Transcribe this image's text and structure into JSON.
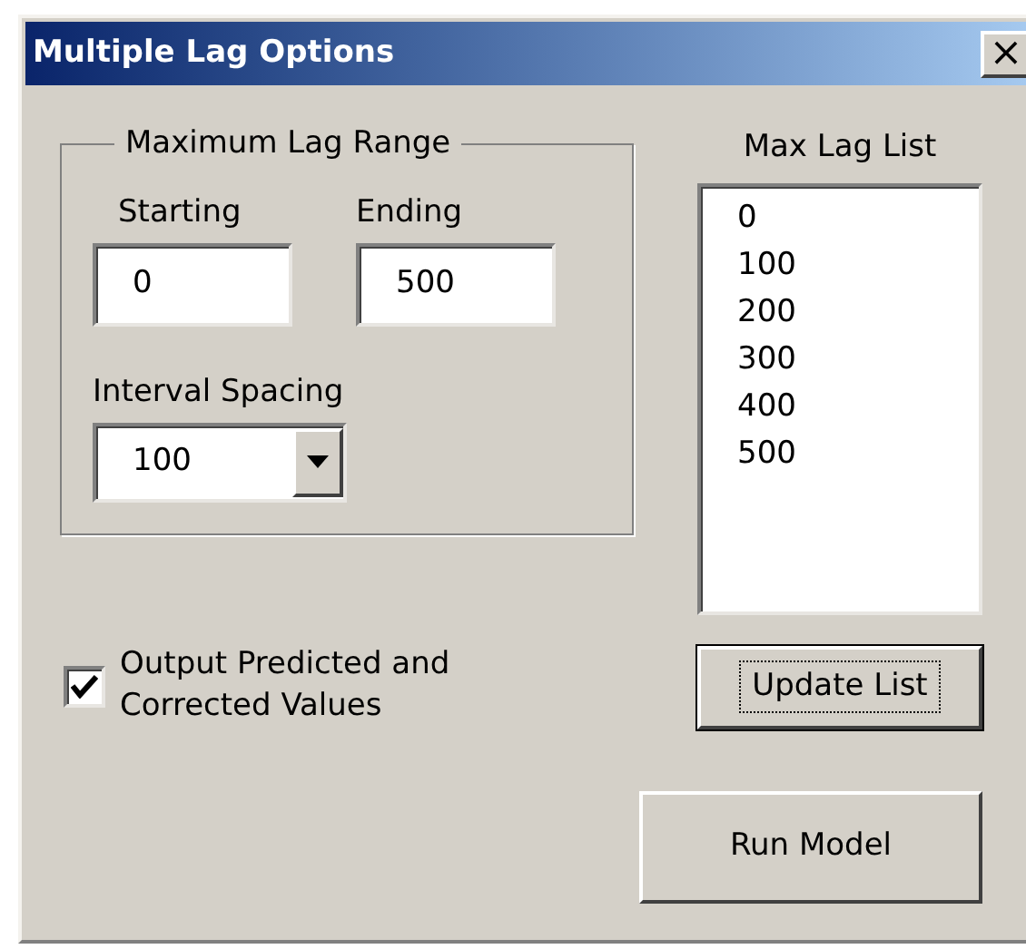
{
  "window": {
    "title": "Multiple Lag Options",
    "close": "×"
  },
  "range_group": {
    "legend": "Maximum Lag Range",
    "starting": {
      "label": "Starting",
      "value": "0"
    },
    "ending": {
      "label": "Ending",
      "value": "500"
    },
    "interval": {
      "label": "Interval Spacing",
      "value": "100"
    }
  },
  "output_checkbox": {
    "label": "Output Predicted and Corrected Values",
    "checked": true
  },
  "lag_list": {
    "label": "Max Lag List",
    "items": [
      "0",
      "100",
      "200",
      "300",
      "400",
      "500"
    ]
  },
  "buttons": [
    {
      "label": "Update List",
      "focused": true
    },
    {
      "label": "Run Model",
      "focused": false
    }
  ]
}
